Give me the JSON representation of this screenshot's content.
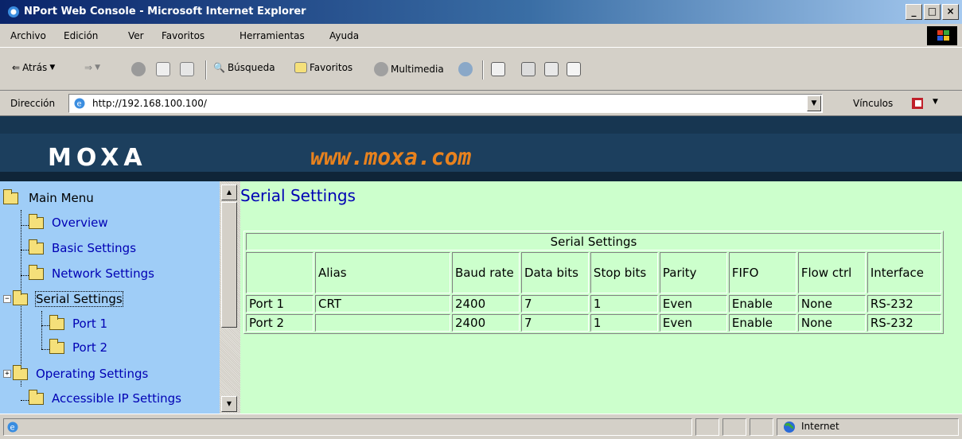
{
  "window": {
    "title": "NPort Web Console - Microsoft Internet Explorer",
    "buttons": [
      "_",
      "□",
      "×"
    ]
  },
  "menu": [
    {
      "label": "Archivo"
    },
    {
      "label": "Edición"
    },
    {
      "label": "Ver"
    },
    {
      "label": "Favoritos"
    },
    {
      "label": "Herramientas"
    },
    {
      "label": "Ayuda"
    }
  ],
  "toolbar": {
    "back": "Atrás",
    "search": "Búsqueda",
    "favorites": "Favoritos",
    "media": "Multimedia"
  },
  "address": {
    "label": "Dirección",
    "url": "http://192.168.100.100/",
    "links": "Vínculos"
  },
  "banner": {
    "logo": "MOXA",
    "site": "www.moxa.com"
  },
  "tree": {
    "root": "Main Menu",
    "items": [
      {
        "label": "Overview"
      },
      {
        "label": "Basic Settings"
      },
      {
        "label": "Network Settings"
      },
      {
        "label": "Serial Settings"
      },
      {
        "label": "Port 1"
      },
      {
        "label": "Port 2"
      },
      {
        "label": "Operating Settings"
      },
      {
        "label": "Accessible IP Settings"
      }
    ]
  },
  "main": {
    "title": "Serial Settings",
    "table": {
      "caption": "Serial Settings",
      "headers": [
        "",
        "Alias",
        "Baud rate",
        "Data bits",
        "Stop bits",
        "Parity",
        "FIFO",
        "Flow ctrl",
        "Interface"
      ],
      "rows": [
        [
          "Port 1",
          "CRT",
          "2400",
          "7",
          "1",
          "Even",
          "Enable",
          "None",
          "RS-232"
        ],
        [
          "Port 2",
          "",
          "2400",
          "7",
          "1",
          "Even",
          "Enable",
          "None",
          "RS-232"
        ]
      ]
    }
  },
  "status": {
    "zone": "Internet"
  },
  "colors": {
    "sidebar_bg": "#9fcdf7",
    "content_bg": "#ccffcc",
    "link_color": "#0000b4",
    "banner_bg": "#1c3f5e",
    "site_text": "#e8821e"
  }
}
